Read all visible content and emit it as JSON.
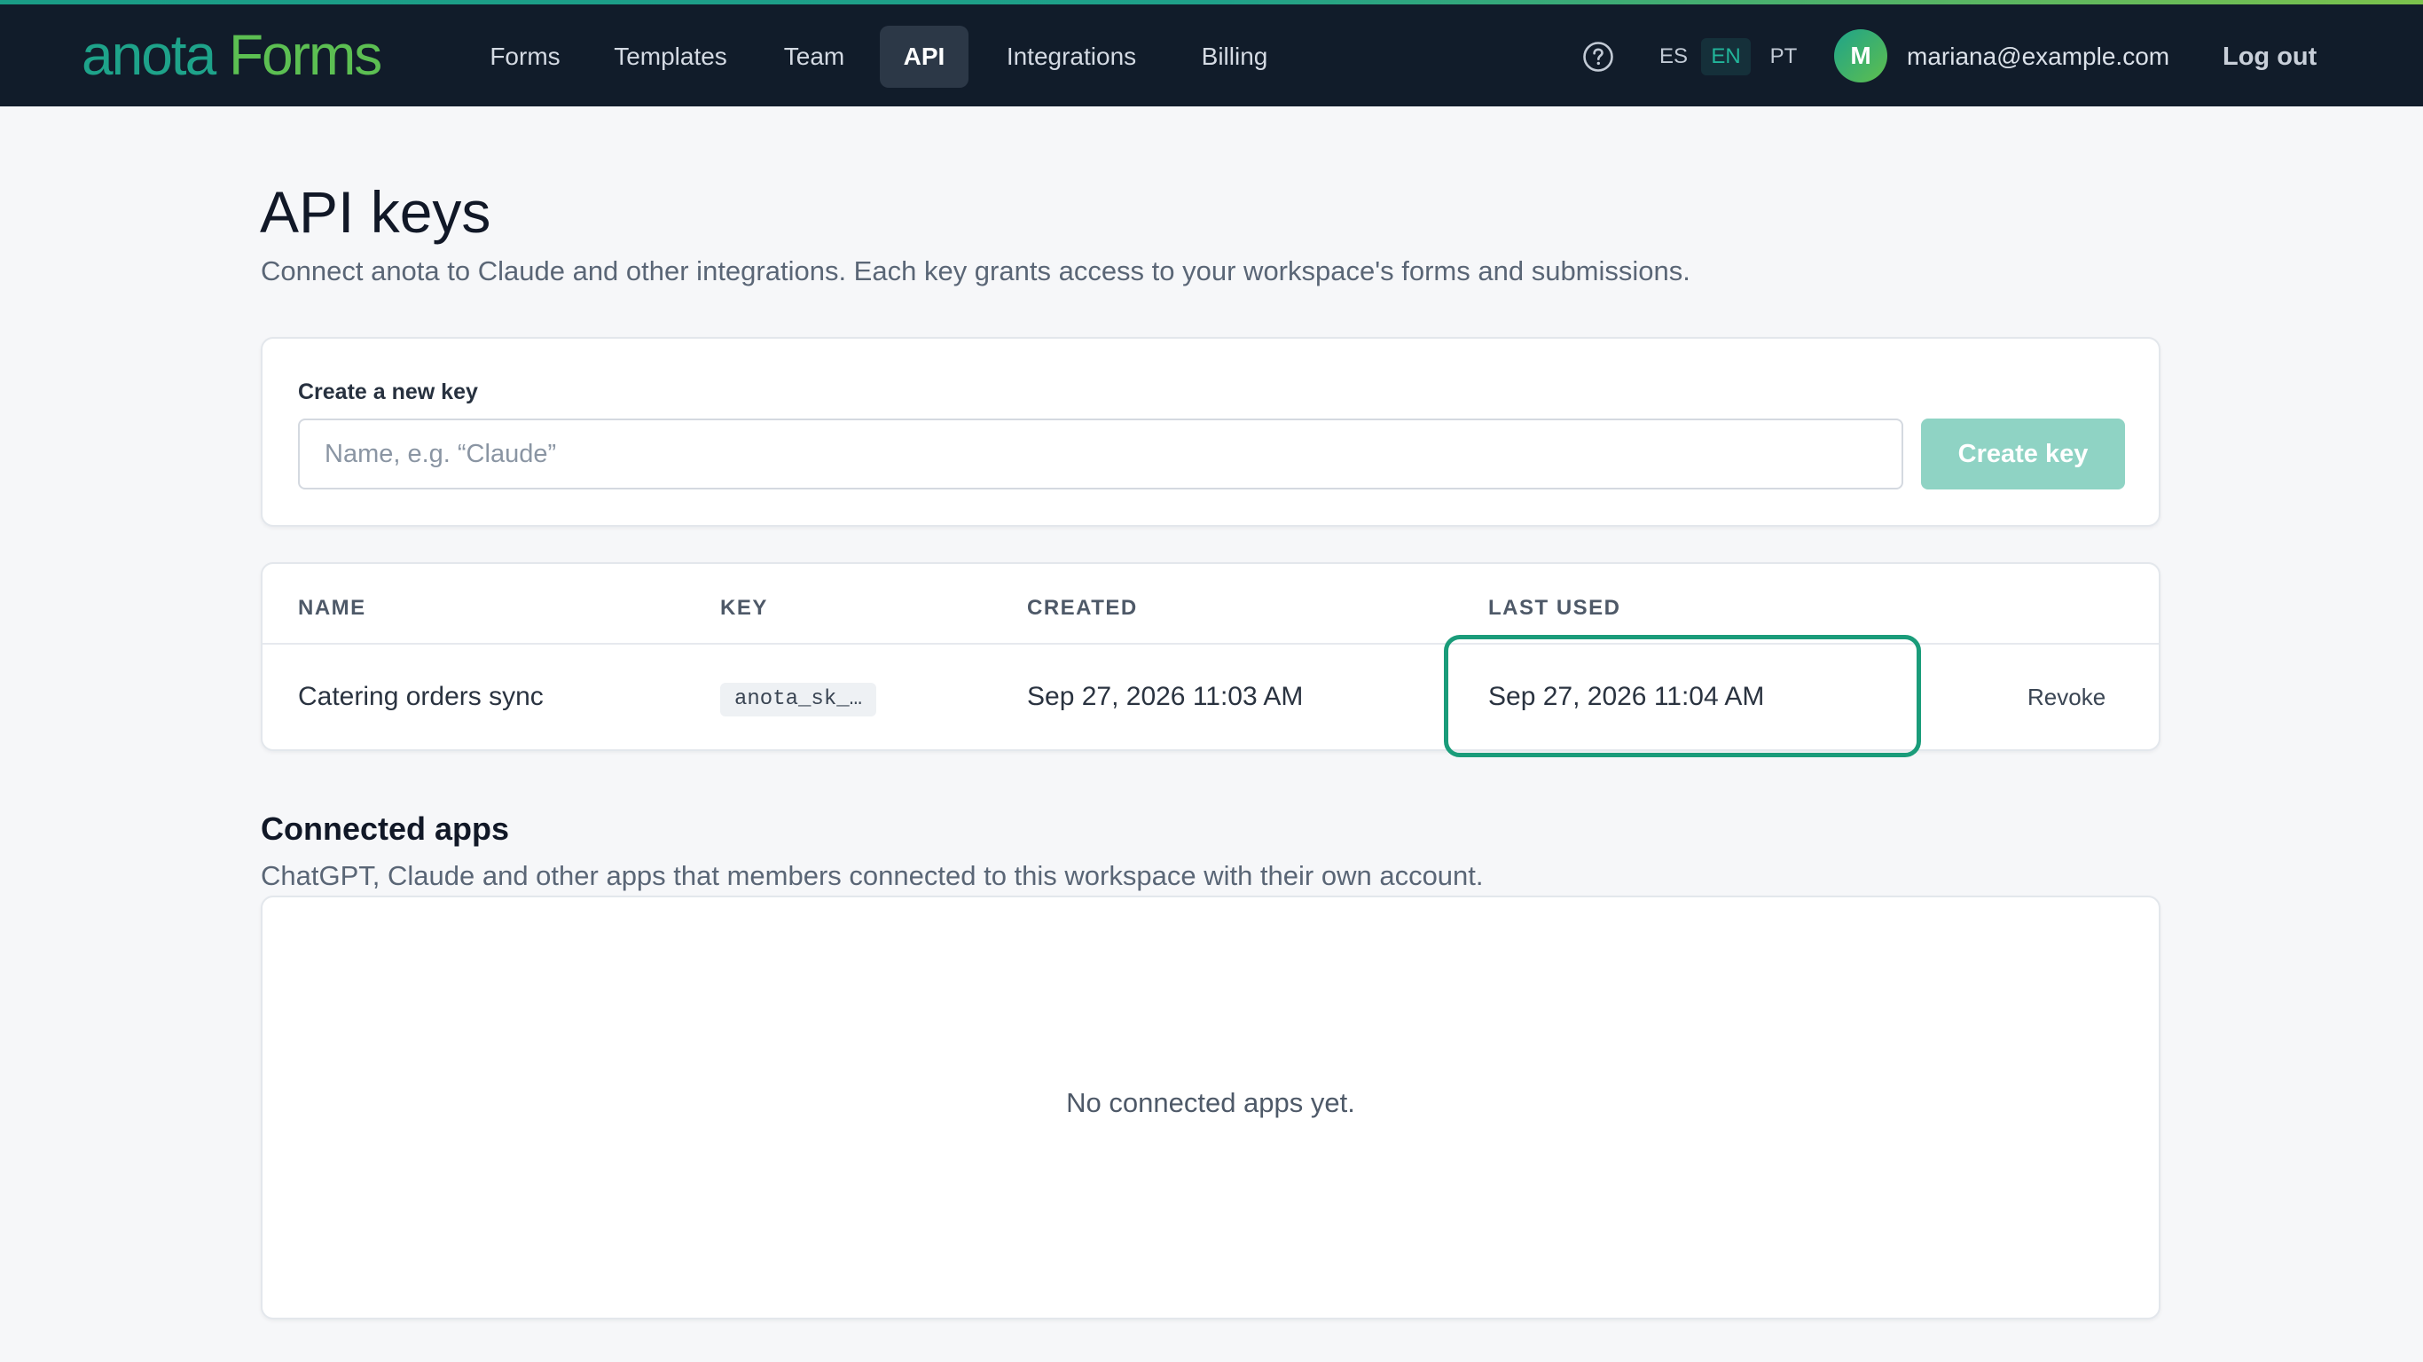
{
  "brand": {
    "logo_part1": "anota",
    "logo_part2": "Forms",
    "accent_color": "#1ea38a",
    "accent_color_secondary": "#5cbf52"
  },
  "nav": {
    "items": [
      {
        "label": "Forms",
        "active": false
      },
      {
        "label": "Templates",
        "active": false
      },
      {
        "label": "Team",
        "active": false
      },
      {
        "label": "API",
        "active": true
      },
      {
        "label": "Integrations",
        "active": false
      },
      {
        "label": "Billing",
        "active": false
      }
    ],
    "help_icon": "question-circle-icon",
    "languages": [
      {
        "code": "ES",
        "active": false
      },
      {
        "code": "EN",
        "active": true
      },
      {
        "code": "PT",
        "active": false
      }
    ],
    "user": {
      "avatar_initial": "M",
      "email": "mariana@example.com"
    },
    "logout_label": "Log out"
  },
  "page": {
    "title": "API keys",
    "subtitle": "Connect anota to Claude and other integrations. Each key grants access to your workspace's forms and submissions."
  },
  "create_key": {
    "label": "Create a new key",
    "input_value": "",
    "placeholder": "Name, e.g. “Claude”",
    "button_label": "Create key",
    "button_color": "#8fd3c4"
  },
  "keys_table": {
    "headers": {
      "name": "NAME",
      "key": "KEY",
      "created": "CREATED",
      "last_used": "LAST USED"
    },
    "rows": [
      {
        "name": "Catering orders sync",
        "key": "anota_sk_…",
        "created": "Sep 27, 2026 11:03 AM",
        "last_used": "Sep 27, 2026 11:04 AM",
        "action": "Revoke"
      }
    ],
    "highlight_color": "#1a9c7a"
  },
  "connected_apps": {
    "title": "Connected apps",
    "subtitle": "ChatGPT, Claude and other apps that members connected to this workspace with their own account.",
    "empty_message": "No connected apps yet."
  }
}
